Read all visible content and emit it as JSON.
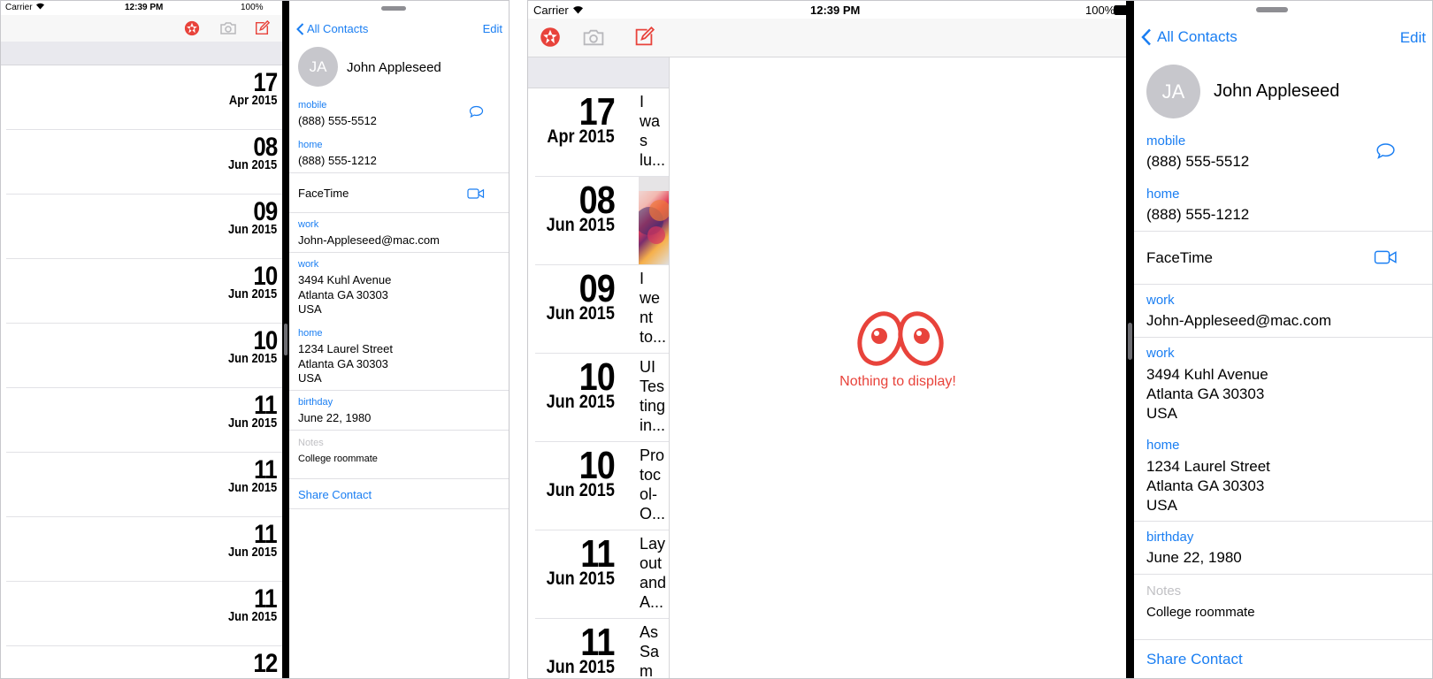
{
  "status": {
    "carrier": "Carrier",
    "time": "12:39 PM",
    "battery": "100%"
  },
  "journal": {
    "icons": [
      "shutter-icon",
      "camera-icon",
      "compose-icon"
    ],
    "entries": [
      {
        "day": "17",
        "month": "Apr 2015",
        "snippet": "I was lu..."
      },
      {
        "day": "08",
        "month": "Jun 2015",
        "snippet": ""
      },
      {
        "day": "09",
        "month": "Jun 2015",
        "snippet": "I went to..."
      },
      {
        "day": "10",
        "month": "Jun 2015",
        "snippet": "UI Testing in..."
      },
      {
        "day": "10",
        "month": "Jun 2015",
        "snippet": "Protocol-O..."
      },
      {
        "day": "11",
        "month": "Jun 2015",
        "snippet": "Layout and A..."
      },
      {
        "day": "11",
        "month": "Jun 2015",
        "snippet": "As Sam"
      },
      {
        "day": "11",
        "month": "Jun 2015",
        "snippet": ""
      },
      {
        "day": "11",
        "month": "Jun 2015",
        "snippet": ""
      },
      {
        "day": "12",
        "month": "",
        "snippet": ""
      }
    ],
    "snippets_right": [
      [
        "I",
        "wa",
        "s",
        "lu..."
      ],
      [],
      [
        "I",
        "we",
        "nt",
        "to..."
      ],
      [
        "UI",
        "Tes",
        "ting",
        "in..."
      ],
      [
        "Pro",
        "toc",
        "ol-",
        "O..."
      ],
      [
        "Lay",
        "out",
        "and",
        "A..."
      ],
      [
        "As",
        "Sa",
        "m"
      ]
    ],
    "empty_message": "Nothing to display!"
  },
  "contact": {
    "back_label": "All Contacts",
    "edit_label": "Edit",
    "initials": "JA",
    "name": "John Appleseed",
    "mobile_label": "mobile",
    "mobile_value": "(888) 555-5512",
    "home_label": "home",
    "home_value": "(888) 555-1212",
    "facetime_label": "FaceTime",
    "work_email_label": "work",
    "work_email_value": "John-Appleseed@mac.com",
    "work_address_label": "work",
    "work_address_value": "3494 Kuhl Avenue\nAtlanta GA 30303\nUSA",
    "home_address_label": "home",
    "home_address_value": "1234 Laurel Street\nAtlanta GA 30303\nUSA",
    "birthday_label": "birthday",
    "birthday_value": "June 22, 1980",
    "notes_label": "Notes",
    "notes_value": "College roommate",
    "share_label": "Share Contact"
  },
  "colors": {
    "accent": "#1a7ef2",
    "brand_red": "#e8433b",
    "toolbar_bg": "#f7f7f7"
  }
}
